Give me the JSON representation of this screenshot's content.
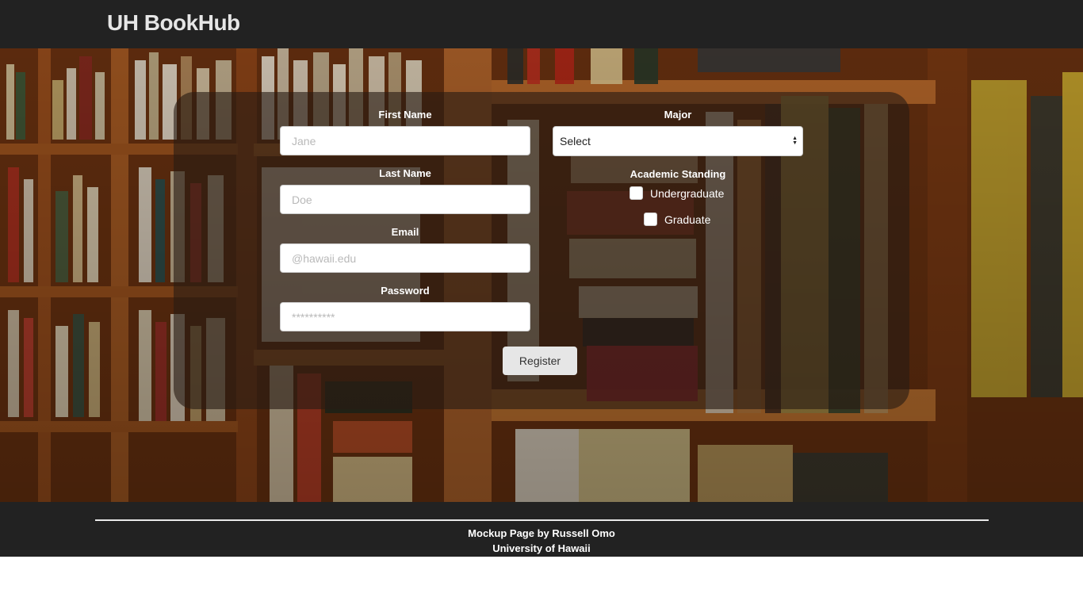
{
  "header": {
    "brand": "UH BookHub"
  },
  "form": {
    "first_name": {
      "label": "First Name",
      "placeholder": "Jane"
    },
    "last_name": {
      "label": "Last Name",
      "placeholder": "Doe"
    },
    "email": {
      "label": "Email",
      "placeholder": "@hawaii.edu"
    },
    "password": {
      "label": "Password",
      "placeholder": "**********"
    },
    "major": {
      "label": "Major",
      "selected": "Select"
    },
    "academic_standing": {
      "label": "Academic Standing",
      "options": [
        {
          "label": "Undergraduate",
          "checked": false
        },
        {
          "label": "Graduate",
          "checked": false
        }
      ]
    },
    "register_label": "Register"
  },
  "footer": {
    "line1": "Mockup Page by Russell Omo",
    "line2": "University of Hawaii"
  },
  "colors": {
    "navbar": "#222222",
    "panel": "rgba(40,28,20,0.62)",
    "button": "#e6e6e6"
  }
}
